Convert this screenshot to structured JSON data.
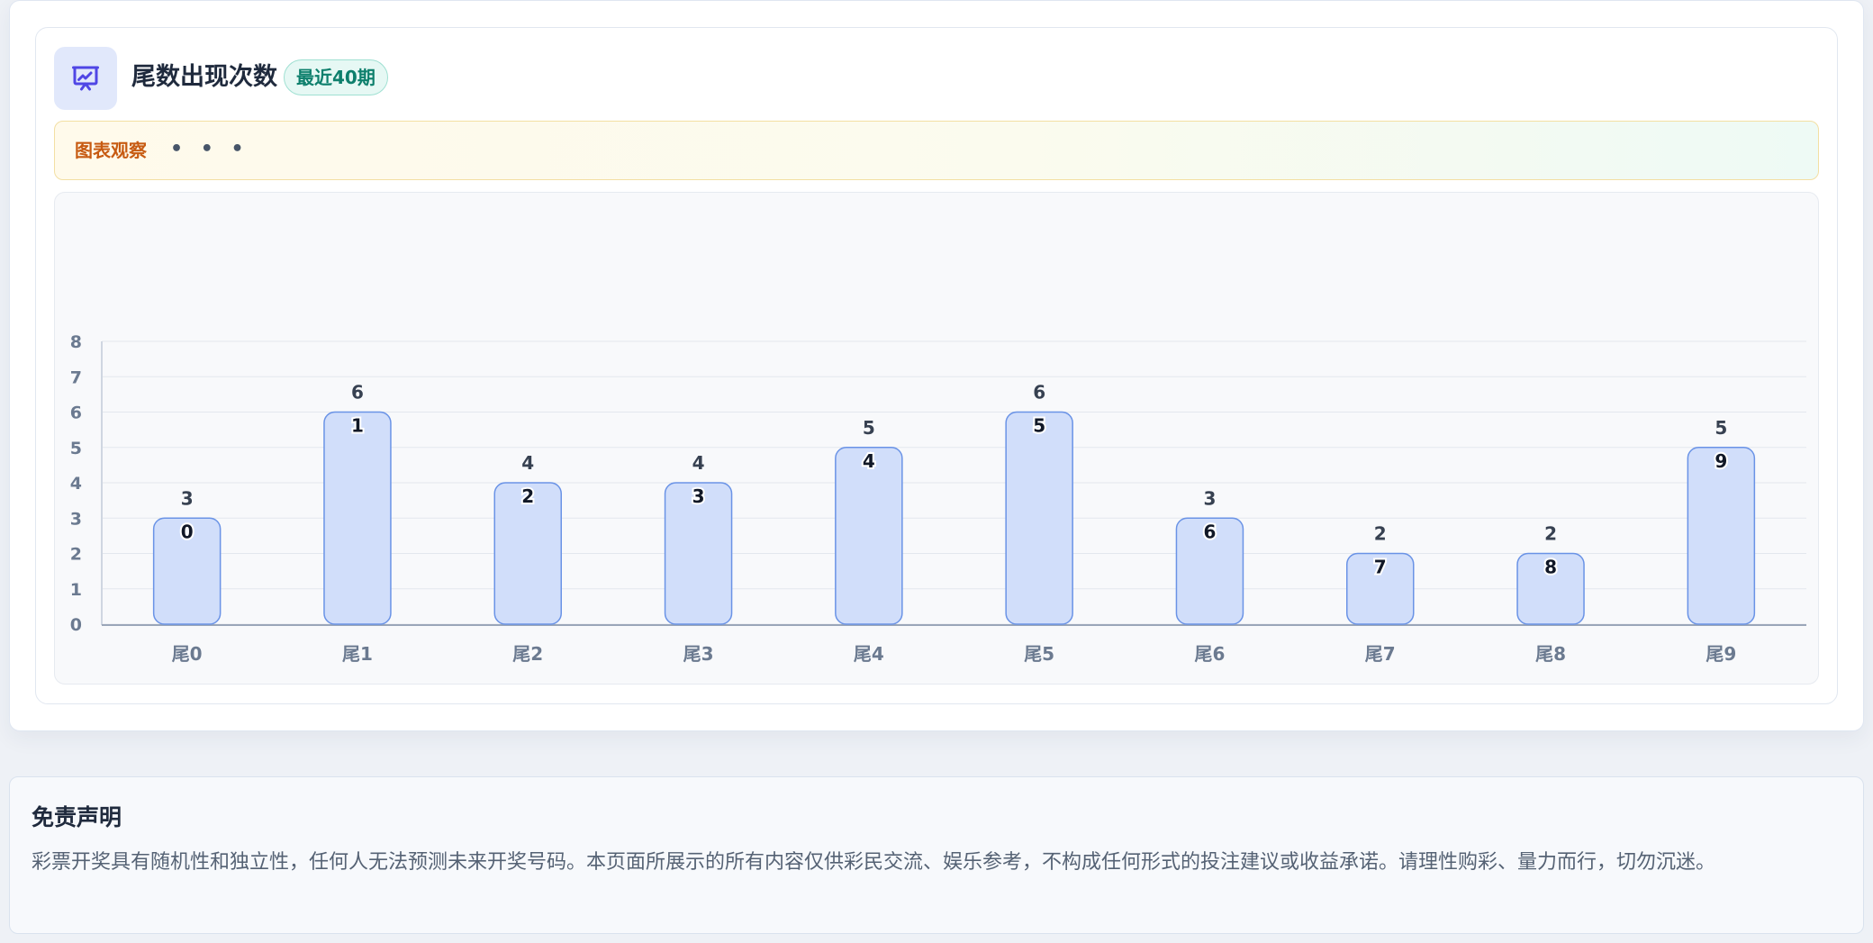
{
  "header": {
    "title": "尾数出现次数",
    "badge": "最近40期",
    "icon": "presentation-chart-icon"
  },
  "observation": {
    "label": "图表观察",
    "dots": "• • •"
  },
  "colors": {
    "accent": "#4f46e5",
    "bar_fill": "#d1defa",
    "bar_stroke": "#6a93e6",
    "badge_text": "#0d7f6c",
    "observe_label": "#c75b12"
  },
  "chart_data": {
    "type": "bar",
    "categories": [
      "尾0",
      "尾1",
      "尾2",
      "尾3",
      "尾4",
      "尾5",
      "尾6",
      "尾7",
      "尾8",
      "尾9"
    ],
    "values": [
      3,
      6,
      4,
      4,
      5,
      6,
      3,
      2,
      2,
      5
    ],
    "inner_labels": [
      "0",
      "1",
      "2",
      "3",
      "4",
      "5",
      "6",
      "7",
      "8",
      "9"
    ],
    "yticks": [
      "0",
      "1",
      "2",
      "3",
      "4",
      "5",
      "6",
      "7",
      "8"
    ],
    "ylim": [
      0,
      8
    ],
    "grid": true,
    "legend": "none"
  },
  "disclaimer": {
    "title": "免责声明",
    "text": "彩票开奖具有随机性和独立性，任何人无法预测未来开奖号码。本页面所展示的所有内容仅供彩民交流、娱乐参考，不构成任何形式的投注建议或收益承诺。请理性购彩、量力而行，切勿沉迷。"
  }
}
